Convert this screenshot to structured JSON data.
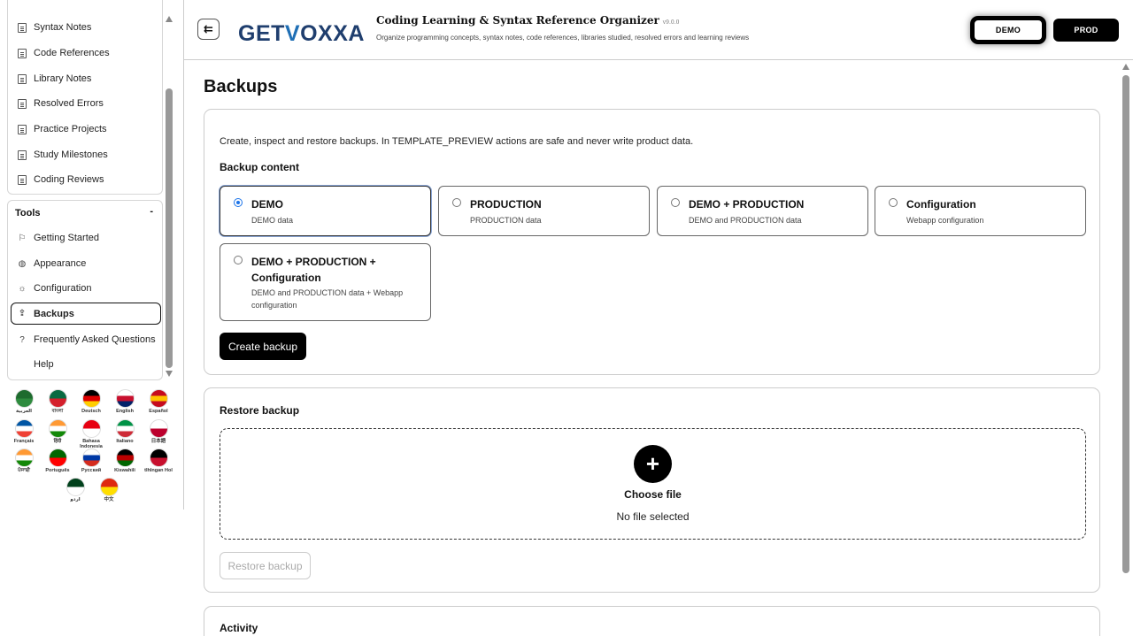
{
  "sidebar": {
    "nav_items": [
      {
        "label": "Syntax Notes"
      },
      {
        "label": "Code References"
      },
      {
        "label": "Library Notes"
      },
      {
        "label": "Resolved Errors"
      },
      {
        "label": "Practice Projects"
      },
      {
        "label": "Study Milestones"
      },
      {
        "label": "Coding Reviews"
      }
    ],
    "tools": {
      "title": "Tools",
      "collapse": "-",
      "items": [
        {
          "label": "Getting Started",
          "icon": "flag-icon"
        },
        {
          "label": "Appearance",
          "icon": "palette-icon"
        },
        {
          "label": "Configuration",
          "icon": "gear-icon"
        },
        {
          "label": "Backups",
          "icon": "upload-icon"
        },
        {
          "label": "Frequently Asked Questions",
          "icon": "question-icon"
        },
        {
          "label": "Help",
          "icon": ""
        }
      ]
    },
    "languages": [
      {
        "label": "العربية",
        "colors": [
          "#1e6b2e",
          "#2e8b3e"
        ]
      },
      {
        "label": "বাংলা",
        "colors": [
          "#0a6a42",
          "#d4202c"
        ]
      },
      {
        "label": "Deutsch",
        "colors": [
          "#000000",
          "#dd0000",
          "#ffce00"
        ]
      },
      {
        "label": "English",
        "colors": [
          "#ffffff",
          "#c8102e",
          "#012169"
        ]
      },
      {
        "label": "Español",
        "colors": [
          "#c60b1e",
          "#ffc400",
          "#c60b1e"
        ]
      },
      {
        "label": "Français",
        "colors": [
          "#0055a4",
          "#ffffff",
          "#ef4135"
        ]
      },
      {
        "label": "हिंदी",
        "colors": [
          "#ff9933",
          "#ffffff",
          "#138808"
        ]
      },
      {
        "label": "Bahasa Indonesia",
        "colors": [
          "#e70011",
          "#ffffff"
        ]
      },
      {
        "label": "Italiano",
        "colors": [
          "#009246",
          "#ffffff",
          "#ce2b37"
        ]
      },
      {
        "label": "日本語",
        "colors": [
          "#ffffff",
          "#bc002d"
        ]
      },
      {
        "label": "ਪੰਜਾਬੀ",
        "colors": [
          "#ff9933",
          "#ffffff",
          "#138808"
        ]
      },
      {
        "label": "Português",
        "colors": [
          "#006600",
          "#ff0000"
        ]
      },
      {
        "label": "Русский",
        "colors": [
          "#ffffff",
          "#0039a6",
          "#d52b1e"
        ]
      },
      {
        "label": "Kiswahili",
        "colors": [
          "#000000",
          "#bb0000",
          "#006600"
        ]
      },
      {
        "label": "tlhIngan Hol",
        "colors": [
          "#000000",
          "#c8102e"
        ]
      },
      {
        "label": "اردو",
        "colors": [
          "#01411c",
          "#ffffff"
        ]
      },
      {
        "label": "中文",
        "colors": [
          "#de2910",
          "#ffde00"
        ]
      }
    ]
  },
  "header": {
    "collapse_icon": "collapse-sidebar-icon",
    "logo": {
      "part1": "GET",
      "part2": "V",
      "part3": "OXXA"
    },
    "title": "Coding Learning & Syntax Reference Organizer",
    "version": "v9.0.0",
    "subtitle": "Organize programming concepts, syntax notes, code references, libraries studied, resolved errors and learning reviews",
    "env_demo": "DEMO",
    "env_prod": "PROD"
  },
  "main": {
    "page_title": "Backups",
    "create": {
      "intro": "Create, inspect and restore backups. In TEMPLATE_PREVIEW actions are safe and never write product data.",
      "heading": "Backup content",
      "options": [
        {
          "title": "DEMO",
          "desc": "DEMO data",
          "selected": true
        },
        {
          "title": "PRODUCTION",
          "desc": "PRODUCTION data",
          "selected": false
        },
        {
          "title": "DEMO + PRODUCTION",
          "desc": "DEMO and PRODUCTION data",
          "selected": false
        },
        {
          "title": "Configuration",
          "desc": "Webapp configuration",
          "selected": false
        },
        {
          "title": "DEMO + PRODUCTION + Configuration",
          "desc": "DEMO and PRODUCTION data + Webapp configuration",
          "selected": false
        }
      ],
      "button": "Create backup"
    },
    "restore": {
      "heading": "Restore backup",
      "choose": "Choose file",
      "no_file": "No file selected",
      "button": "Restore backup"
    },
    "activity": {
      "heading": "Activity"
    }
  }
}
